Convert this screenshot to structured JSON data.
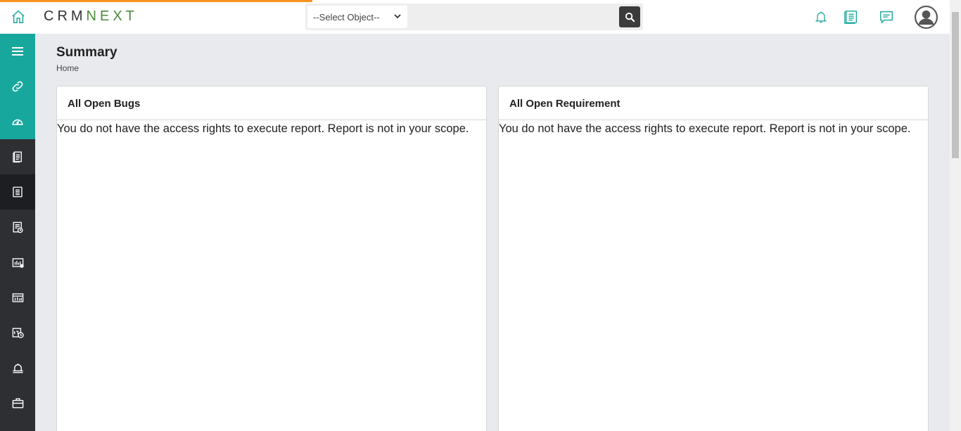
{
  "app": {
    "logo_left": "CRM",
    "logo_right": "NEXT"
  },
  "search": {
    "select_label": "--Select Object--"
  },
  "header_icons": [
    "bell-icon",
    "notes-icon",
    "chat-icon",
    "user-avatar"
  ],
  "sidebar": {
    "items": [
      {
        "icon": "menu-icon"
      },
      {
        "icon": "link-icon"
      },
      {
        "icon": "speedometer-icon"
      },
      {
        "icon": "document-icon"
      },
      {
        "icon": "list-document-icon"
      },
      {
        "icon": "report-icon"
      },
      {
        "icon": "chart-board-icon"
      },
      {
        "icon": "bar-board-icon"
      },
      {
        "icon": "calendar-clock-icon"
      },
      {
        "icon": "alarm-icon"
      },
      {
        "icon": "briefcase-icon"
      }
    ]
  },
  "page": {
    "title": "Summary",
    "breadcrumb": "Home"
  },
  "cards": [
    {
      "title": "All Open Bugs",
      "message": "You do not have the access rights to execute report. Report is not in your scope."
    },
    {
      "title": "All Open Requirement",
      "message": "You do not have the access rights to execute report. Report is not in your scope."
    }
  ],
  "colors": {
    "accent": "#17a79d",
    "progress": "#f7941d",
    "sidebar": "#2e2f33",
    "logo_green": "#4a8c3a"
  }
}
